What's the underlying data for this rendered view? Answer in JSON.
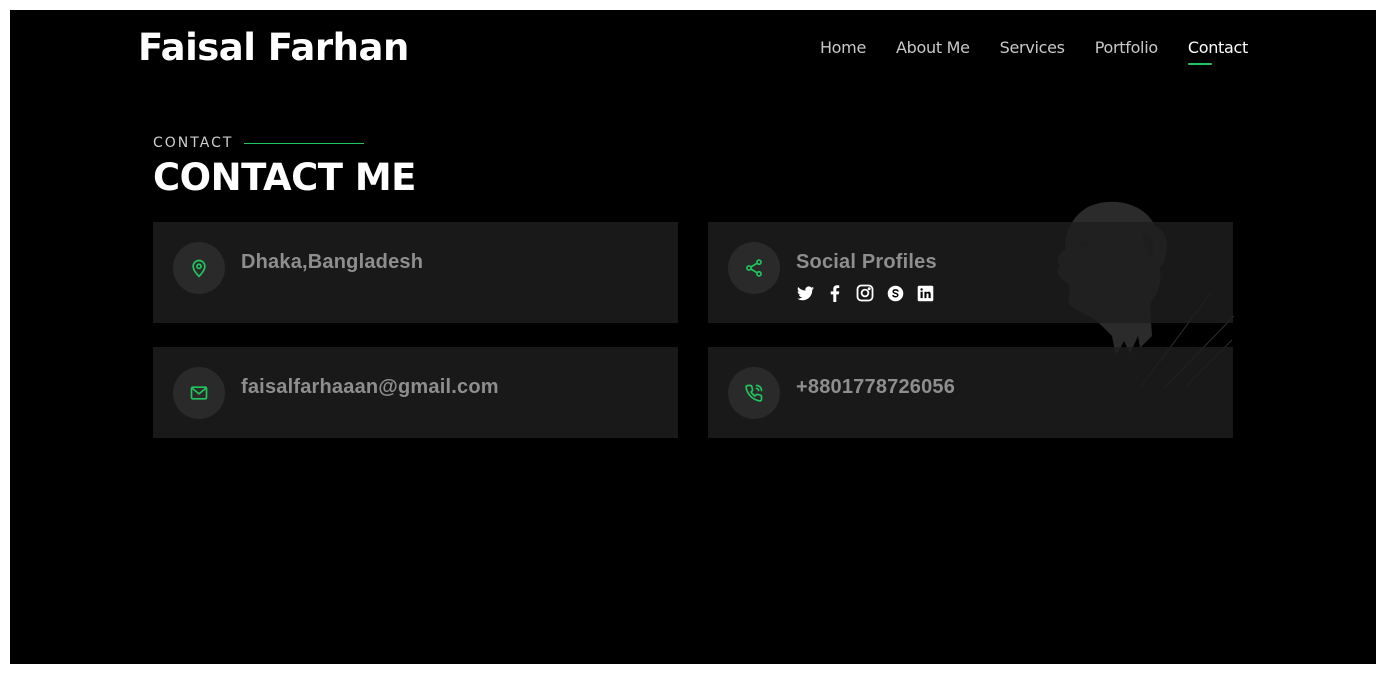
{
  "brand": {
    "name": "Faisal Farhan"
  },
  "nav": {
    "items": [
      "Home",
      "About Me",
      "Services",
      "Portfolio",
      "Contact"
    ],
    "active": "Contact"
  },
  "section": {
    "eyebrow": "CONTACT",
    "title": "CONTACT ME"
  },
  "contact": {
    "location": "Dhaka,Bangladesh",
    "social_title": "Social Profiles",
    "social_icons": [
      "twitter-icon",
      "facebook-icon",
      "instagram-icon",
      "skype-icon",
      "linkedin-icon"
    ],
    "email": "faisalfarhaaan@gmail.com",
    "phone": "+8801778726056"
  },
  "colors": {
    "accent": "#22c55e",
    "background": "#000000",
    "card": "#1e1e1e"
  }
}
